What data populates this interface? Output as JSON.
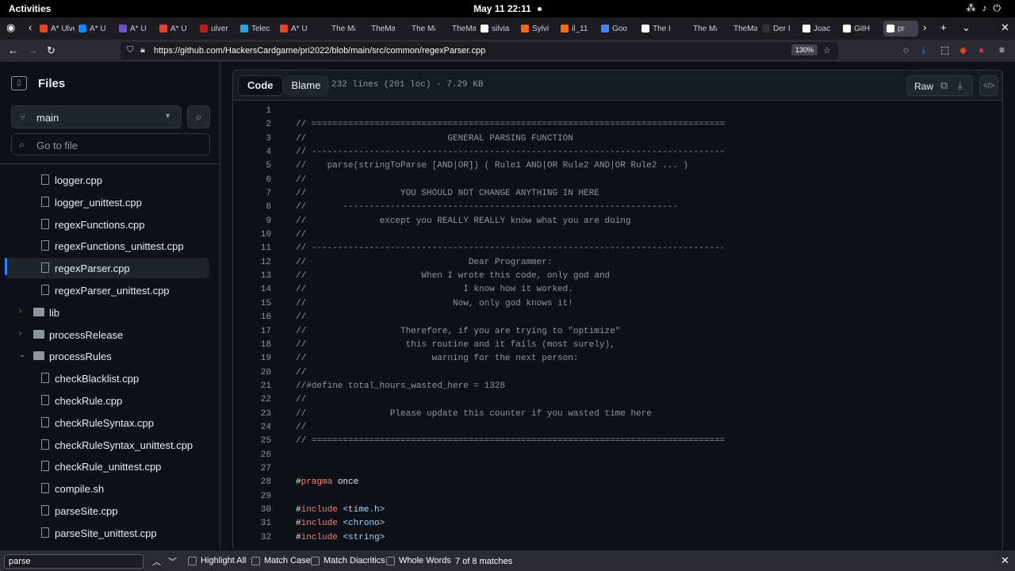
{
  "gnome": {
    "activities": "Activities",
    "clock": "May 11  22:11"
  },
  "tabs": [
    {
      "label": "A* Ulven",
      "color": "#e24329"
    },
    {
      "label": "A* U",
      "color": "#1185fe"
    },
    {
      "label": "A* U",
      "color": "#6e56cf"
    },
    {
      "label": "A* U",
      "color": "#e24329"
    },
    {
      "label": "ulver",
      "color": "#b22222"
    },
    {
      "label": "Telec",
      "color": "#2aa3de"
    },
    {
      "label": "A* U",
      "color": "#e24329"
    },
    {
      "label": "The Mag",
      "color": "#1c1b22"
    },
    {
      "label": "TheMag",
      "color": "#1c1b22"
    },
    {
      "label": "The Mag",
      "color": "#1c1b22"
    },
    {
      "label": "TheMag",
      "color": "#1c1b22"
    },
    {
      "label": "silvia",
      "color": "#ffffff"
    },
    {
      "label": "Sylvi",
      "color": "#f26b1d"
    },
    {
      "label": "il_11",
      "color": "#f26b1d"
    },
    {
      "label": "Goo",
      "color": "#4285f4"
    },
    {
      "label": "The I",
      "color": "#ffffff"
    },
    {
      "label": "The Mag",
      "color": "#1c1b22"
    },
    {
      "label": "TheMag",
      "color": "#1c1b22"
    },
    {
      "label": "Der I",
      "color": "#333333"
    },
    {
      "label": "Joac",
      "color": "#ffffff"
    },
    {
      "label": "GitH",
      "color": "#ffffff"
    },
    {
      "label": "pr",
      "color": "#ffffff"
    }
  ],
  "browser": {
    "url": "https://github.com/HackersCardgame/pri2022/blob/main/src/common/regexParser.cpp",
    "zoom": "130%"
  },
  "sidebar": {
    "title": "Files",
    "branch": "main",
    "goto_placeholder": "Go to file",
    "items": [
      {
        "name": "logger.cpp",
        "type": "file",
        "depth": 2,
        "selected": false
      },
      {
        "name": "logger_unittest.cpp",
        "type": "file",
        "depth": 2,
        "selected": false
      },
      {
        "name": "regexFunctions.cpp",
        "type": "file",
        "depth": 2,
        "selected": false
      },
      {
        "name": "regexFunctions_unittest.cpp",
        "type": "file",
        "depth": 2,
        "selected": false
      },
      {
        "name": "regexParser.cpp",
        "type": "file",
        "depth": 2,
        "selected": true
      },
      {
        "name": "regexParser_unittest.cpp",
        "type": "file",
        "depth": 2,
        "selected": false
      },
      {
        "name": "lib",
        "type": "folder",
        "depth": 1,
        "open": false
      },
      {
        "name": "processRelease",
        "type": "folder",
        "depth": 1,
        "open": false
      },
      {
        "name": "processRules",
        "type": "folder",
        "depth": 1,
        "open": true
      },
      {
        "name": "checkBlacklist.cpp",
        "type": "file",
        "depth": 2,
        "selected": false
      },
      {
        "name": "checkRule.cpp",
        "type": "file",
        "depth": 2,
        "selected": false
      },
      {
        "name": "checkRuleSyntax.cpp",
        "type": "file",
        "depth": 2,
        "selected": false
      },
      {
        "name": "checkRuleSyntax_unittest.cpp",
        "type": "file",
        "depth": 2,
        "selected": false
      },
      {
        "name": "checkRule_unittest.cpp",
        "type": "file",
        "depth": 2,
        "selected": false
      },
      {
        "name": "compile.sh",
        "type": "file",
        "depth": 2,
        "selected": false
      },
      {
        "name": "parseSite.cpp",
        "type": "file",
        "depth": 2,
        "selected": false
      },
      {
        "name": "parseSite_unittest.cpp",
        "type": "file",
        "depth": 2,
        "selected": false
      }
    ]
  },
  "codeview": {
    "tab_code": "Code",
    "tab_blame": "Blame",
    "fileinfo": "232 lines (201 loc) · 7.29 KB",
    "raw": "Raw",
    "lines": [
      {
        "n": "1",
        "segs": [
          {
            "t": "",
            "c": "cm"
          }
        ]
      },
      {
        "n": "2",
        "segs": [
          {
            "t": "// ===============================================================================",
            "c": "cm"
          }
        ]
      },
      {
        "n": "3",
        "segs": [
          {
            "t": "//                           GENERAL PARSING FUNCTION",
            "c": "cm"
          }
        ]
      },
      {
        "n": "4",
        "segs": [
          {
            "t": "// -------------------------------------------------------------------------------",
            "c": "cm"
          }
        ]
      },
      {
        "n": "5",
        "segs": [
          {
            "t": "//    parse(stringToParse [AND|OR]) ( Rule1 AND|OR Rule2 AND|OR Rule2 ... )",
            "c": "cm"
          }
        ]
      },
      {
        "n": "6",
        "segs": [
          {
            "t": "//",
            "c": "cm"
          }
        ]
      },
      {
        "n": "7",
        "segs": [
          {
            "t": "//                  YOU SHOULD NOT CHANGE ANYTHING IN HERE",
            "c": "cm"
          }
        ]
      },
      {
        "n": "8",
        "segs": [
          {
            "t": "//       ----------------------------------------------------------------",
            "c": "cm"
          }
        ]
      },
      {
        "n": "9",
        "segs": [
          {
            "t": "//              except you REALLY REALLY know what you are doing",
            "c": "cm"
          }
        ]
      },
      {
        "n": "10",
        "segs": [
          {
            "t": "//",
            "c": "cm"
          }
        ]
      },
      {
        "n": "11",
        "segs": [
          {
            "t": "// -------------------------------------------------------------------------------",
            "c": "cm"
          }
        ]
      },
      {
        "n": "12",
        "segs": [
          {
            "t": "//                               Dear Programmer:",
            "c": "cm"
          }
        ]
      },
      {
        "n": "13",
        "segs": [
          {
            "t": "//                      When I wrote this code, only god and",
            "c": "cm"
          }
        ]
      },
      {
        "n": "14",
        "segs": [
          {
            "t": "//                              I know how it worked.",
            "c": "cm"
          }
        ]
      },
      {
        "n": "15",
        "segs": [
          {
            "t": "//                            Now, only god knows it!",
            "c": "cm"
          }
        ]
      },
      {
        "n": "16",
        "segs": [
          {
            "t": "//",
            "c": "cm"
          }
        ]
      },
      {
        "n": "17",
        "segs": [
          {
            "t": "//                  Therefore, if you are trying to \"optimize\"",
            "c": "cm"
          }
        ]
      },
      {
        "n": "18",
        "segs": [
          {
            "t": "//                   this routine and it fails (most surely),",
            "c": "cm"
          }
        ]
      },
      {
        "n": "19",
        "segs": [
          {
            "t": "//                        warning for the next person:",
            "c": "cm"
          }
        ]
      },
      {
        "n": "20",
        "segs": [
          {
            "t": "//",
            "c": "cm"
          }
        ]
      },
      {
        "n": "21",
        "segs": [
          {
            "t": "//#define total_hours_wasted_here = 1328",
            "c": "cm"
          }
        ]
      },
      {
        "n": "22",
        "segs": [
          {
            "t": "//",
            "c": "cm"
          }
        ]
      },
      {
        "n": "23",
        "segs": [
          {
            "t": "//                Please update this counter if you wasted time here",
            "c": "cm"
          }
        ]
      },
      {
        "n": "24",
        "segs": [
          {
            "t": "//",
            "c": "cm"
          }
        ]
      },
      {
        "n": "25",
        "segs": [
          {
            "t": "// ===============================================================================",
            "c": "cm"
          }
        ]
      },
      {
        "n": "26",
        "segs": [
          {
            "t": "",
            "c": "cm"
          }
        ]
      },
      {
        "n": "27",
        "segs": [
          {
            "t": "",
            "c": "cm"
          }
        ]
      },
      {
        "n": "28",
        "segs": [
          {
            "t": "#",
            "c": "plain"
          },
          {
            "t": "pragma",
            "c": "kw"
          },
          {
            "t": " once",
            "c": "plain"
          }
        ]
      },
      {
        "n": "29",
        "segs": [
          {
            "t": "",
            "c": "cm"
          }
        ]
      },
      {
        "n": "30",
        "segs": [
          {
            "t": "#",
            "c": "plain"
          },
          {
            "t": "include",
            "c": "kw"
          },
          {
            "t": " ",
            "c": "plain"
          },
          {
            "t": "<time.h>",
            "c": "str"
          }
        ]
      },
      {
        "n": "31",
        "segs": [
          {
            "t": "#",
            "c": "plain"
          },
          {
            "t": "include",
            "c": "kw"
          },
          {
            "t": " ",
            "c": "plain"
          },
          {
            "t": "<chrono>",
            "c": "str"
          }
        ]
      },
      {
        "n": "32",
        "segs": [
          {
            "t": "#",
            "c": "plain"
          },
          {
            "t": "include",
            "c": "kw"
          },
          {
            "t": " ",
            "c": "plain"
          },
          {
            "t": "<string>",
            "c": "str"
          }
        ]
      }
    ]
  },
  "findbar": {
    "query": "parse",
    "highlight_all": "Highlight All",
    "match_case": "Match Case",
    "match_diacritics": "Match Diacritics",
    "whole_words": "Whole Words",
    "status": "7 of 8 matches"
  }
}
